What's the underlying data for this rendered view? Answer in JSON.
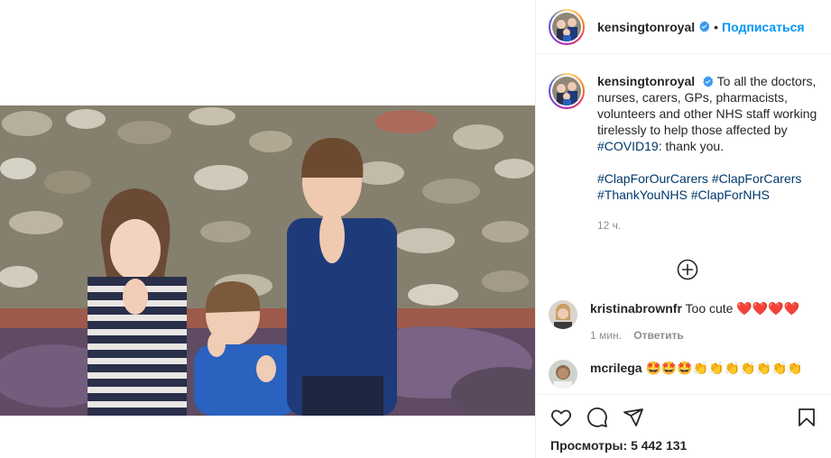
{
  "post_header": {
    "username": "kensingtonroyal",
    "dot": "•",
    "follow_label": "Подписаться"
  },
  "caption": {
    "username": "kensingtonroyal",
    "text": "To all the doctors, nurses, carers, GPs, pharmacists, volunteers and other NHS staff working tirelessly to help those affected by #COVID19: thank you.",
    "hashtags_line1": "#ClapForOurCarers #ClapForCarers",
    "hashtags_line2": "#ThankYouNHS #ClapForNHS",
    "time": "12 ч."
  },
  "comments": [
    {
      "username": "kristinabrownfr",
      "text": "Too cute",
      "emoji": "❤️❤️❤️❤️",
      "time": "1 мин.",
      "reply_label": "Ответить"
    },
    {
      "username": "mcrilega",
      "emoji": "🤩🤩🤩👏👏👏👏👏👏👏"
    }
  ],
  "actions": {
    "views_label": "Просмотры:",
    "views_count": "5 442 131"
  },
  "colors": {
    "link_blue": "#0095f6",
    "hashtag_navy": "#00376b",
    "muted_gray": "#8e8e8e",
    "text": "#262626",
    "heart_red": "#ed1c24"
  },
  "icons": [
    "verified-badge-icon",
    "plus-circle-icon",
    "heart-icon",
    "comment-icon",
    "share-icon",
    "bookmark-icon"
  ]
}
